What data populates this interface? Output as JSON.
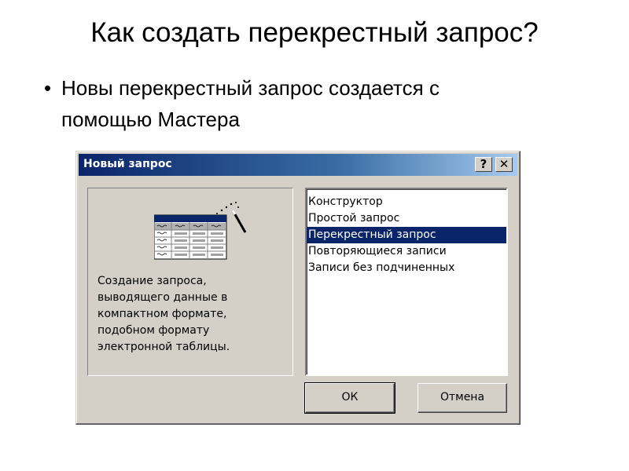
{
  "slide": {
    "title": "Как создать перекрестный запрос?",
    "bullet_marker": "•",
    "bullet_line1": "Новы перекрестный запрос создается с",
    "bullet_line2": "помощью Мастера"
  },
  "dialog": {
    "title": "Новый запрос",
    "help_label": "?",
    "close_label": "✕",
    "description_lines": [
      "Создание запроса,",
      "выводящего данные в",
      "компактном формате,",
      "подобном формату",
      "электронной таблицы."
    ],
    "list_items": [
      "Конструктор",
      "Простой запрос",
      "Перекрестный запрос",
      "Повторяющиеся записи",
      "Записи без подчиненных"
    ],
    "selected_index": 2,
    "ok_label": "ОК",
    "cancel_label": "Отмена",
    "icons": [
      "crosstab-table-icon",
      "magic-wand-icon"
    ],
    "colors": {
      "titlebar_start": "#0a246a",
      "titlebar_end": "#a6caf0",
      "selection": "#0a246a",
      "dialog_face": "#d4d0c8"
    }
  }
}
